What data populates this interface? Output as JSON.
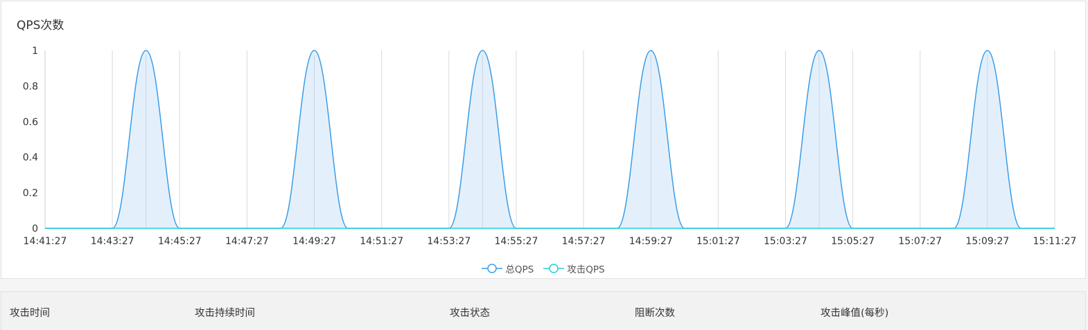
{
  "chart_data": {
    "type": "area",
    "title": "QPS次数",
    "x": [
      "14:41:27",
      "14:43:27",
      "14:45:27",
      "14:47:27",
      "14:49:27",
      "14:51:27",
      "14:53:27",
      "14:55:27",
      "14:57:27",
      "14:59:27",
      "15:01:27",
      "15:03:27",
      "15:05:27",
      "15:07:27",
      "15:09:27",
      "15:11:27"
    ],
    "xlim": [
      "14:41:27",
      "15:11:27"
    ],
    "ylim": [
      0,
      1
    ],
    "yticks": [
      "0",
      "0.2",
      "0.4",
      "0.6",
      "0.8",
      "1"
    ],
    "grid": "vertical",
    "legend_position": "bottom-center",
    "series": [
      {
        "name": "总QPS",
        "color": "#3a9ce8",
        "fill": "#e3f0fc",
        "points": [
          [
            "14:41:27",
            0
          ],
          [
            "14:43:27",
            0
          ],
          [
            "14:44:27",
            1
          ],
          [
            "14:45:27",
            0
          ],
          [
            "14:47:27",
            0
          ],
          [
            "14:48:27",
            0
          ],
          [
            "14:49:27",
            1
          ],
          [
            "14:50:27",
            0
          ],
          [
            "14:52:27",
            0
          ],
          [
            "14:53:27",
            0
          ],
          [
            "14:54:27",
            1
          ],
          [
            "14:55:27",
            0
          ],
          [
            "14:57:27",
            0
          ],
          [
            "14:58:27",
            0
          ],
          [
            "14:59:27",
            1
          ],
          [
            "15:00:27",
            0
          ],
          [
            "15:02:27",
            0
          ],
          [
            "15:03:27",
            0
          ],
          [
            "15:04:27",
            1
          ],
          [
            "15:05:27",
            0
          ],
          [
            "15:07:27",
            0
          ],
          [
            "15:08:27",
            0
          ],
          [
            "15:09:27",
            1
          ],
          [
            "15:10:27",
            0
          ],
          [
            "15:11:27",
            0
          ]
        ]
      },
      {
        "name": "攻击QPS",
        "color": "#23d0d8",
        "points": [
          [
            "14:41:27",
            0
          ],
          [
            "15:11:27",
            0
          ]
        ]
      }
    ]
  },
  "table": {
    "columns": [
      "攻击时间",
      "攻击持续时间",
      "攻击状态",
      "阻断次数",
      "攻击峰值(每秒)"
    ]
  }
}
